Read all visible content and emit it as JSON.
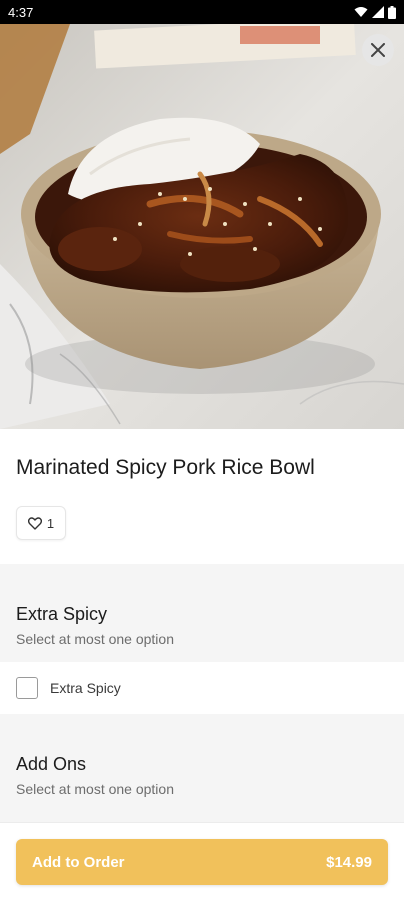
{
  "status_bar": {
    "time": "4:37"
  },
  "product": {
    "title": "Marinated Spicy Pork Rice Bowl",
    "like_count": "1"
  },
  "sections": [
    {
      "title": "Extra Spicy",
      "subtitle": "Select at most one option",
      "options": [
        {
          "label": "Extra Spicy",
          "checked": false
        }
      ]
    },
    {
      "title": "Add Ons",
      "subtitle": "Select at most one option"
    }
  ],
  "footer": {
    "button_label": "Add to Order",
    "price": "$14.99"
  },
  "colors": {
    "accent": "#f1c15b",
    "section_bg": "#f5f5f5"
  },
  "icons": [
    "wifi-icon",
    "signal-icon",
    "battery-icon",
    "close-icon",
    "heart-icon"
  ]
}
